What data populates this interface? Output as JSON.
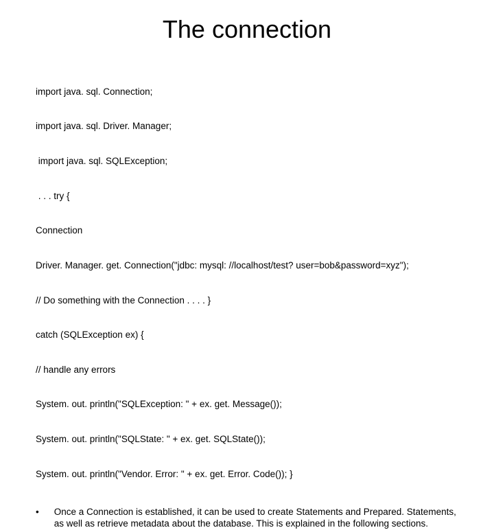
{
  "title": "The connection",
  "code_lines": [
    "import java. sql. Connection;",
    "import java. sql. Driver. Manager;",
    " import java. sql. SQLException;",
    " . . . try {",
    "Connection",
    "Driver. Manager. get. Connection(\"jdbc: mysql: //localhost/test? user=bob&password=xyz\");",
    "// Do something with the Connection . . . . }",
    "catch (SQLException ex) {",
    "// handle any errors",
    "System. out. println(\"SQLException: \" + ex. get. Message());",
    "System. out. println(\"SQLState: \" + ex. get. SQLState());",
    "System. out. println(\"Vendor. Error: \" + ex. get. Error. Code()); }"
  ],
  "bullet": {
    "mark": "•",
    "text": "Once a Connection is established, it can be used to create Statements and Prepared. Statements, as well as retrieve metadata about the database. This is explained in the following sections."
  }
}
